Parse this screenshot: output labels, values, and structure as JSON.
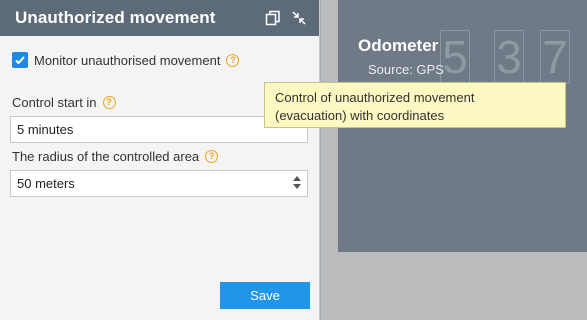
{
  "panel": {
    "title": "Unauthorized movement",
    "monitor_label": "Monitor unauthorised movement",
    "monitor_checked": true,
    "control_start_label": "Control start in",
    "control_start_value": "5  minutes",
    "radius_label": "The radius of the controlled area",
    "radius_value": "50  meters",
    "save_label": "Save"
  },
  "widget": {
    "title": "Odometer",
    "source": "Source: GPS",
    "digits": [
      "5",
      "3",
      "7"
    ]
  },
  "tooltip": {
    "line1": "Control of unauthorized movement",
    "line2": "(evacuation) with coordinates"
  },
  "colors": {
    "header_bg": "#5d6b78",
    "accent": "#2196e8",
    "help_icon": "#f0a21a",
    "tooltip_bg": "#fbf8c2"
  },
  "icons": [
    "copy-icon",
    "collapse-icon",
    "checkmark-icon",
    "help-icon"
  ]
}
